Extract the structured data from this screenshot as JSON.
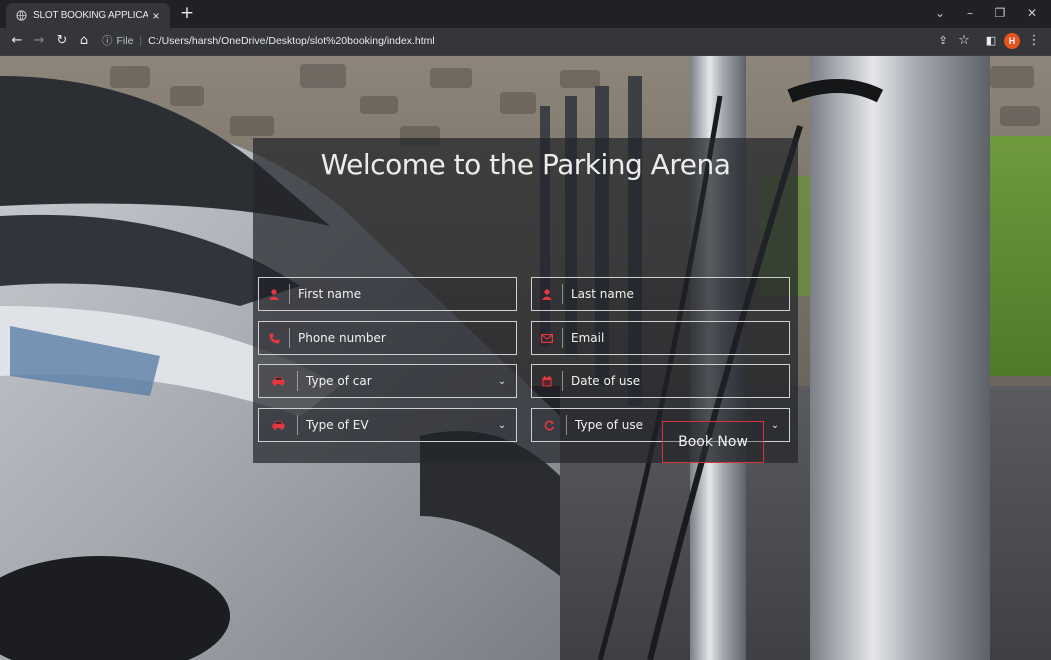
{
  "browser": {
    "tab_title": "SLOT BOOKING APPLICATION",
    "tab_close": "×",
    "new_tab": "+",
    "file_label": "File",
    "url": "C:/Users/harsh/OneDrive/Desktop/slot%20booking/index.html",
    "profile_initial": "H"
  },
  "form": {
    "heading": "Welcome to the Parking Arena",
    "fields": {
      "first_name": "First name",
      "last_name": "Last name",
      "phone": "Phone number",
      "email": "Email",
      "car_type": "Type of car",
      "date_of_use": "Date of use",
      "ev_type": "Type of EV",
      "use_type": "Type of use"
    },
    "submit_label": "Book Now"
  },
  "colors": {
    "accent": "#e8363f",
    "panel": "#23262b",
    "chrome": "#202124"
  },
  "icons": {
    "first_name": "user-icon",
    "last_name": "user-icon",
    "phone": "phone-icon",
    "email": "envelope-icon",
    "car_type": "car-icon",
    "date_of_use": "calendar-icon",
    "ev_type": "car-icon",
    "use_type": "refresh-icon"
  }
}
